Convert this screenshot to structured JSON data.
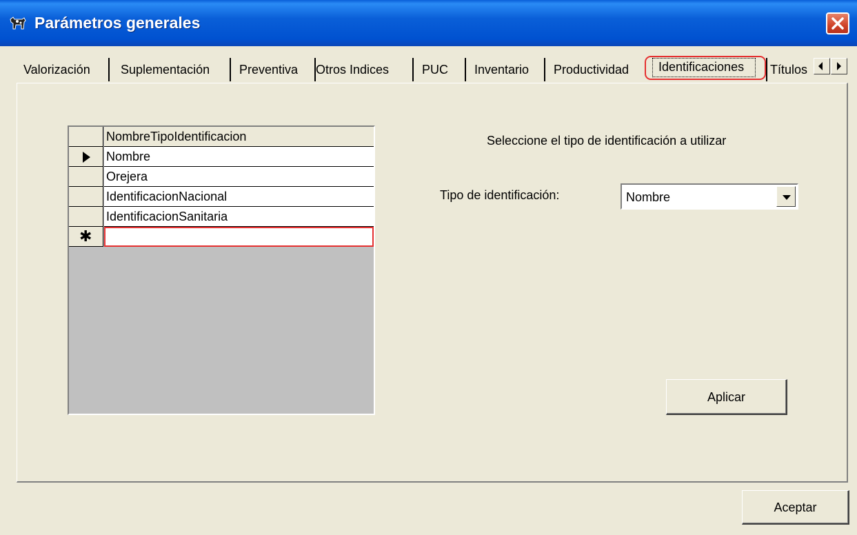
{
  "window": {
    "title": "Parámetros generales"
  },
  "tabs": [
    {
      "label": "Valorización"
    },
    {
      "label": "Suplementación"
    },
    {
      "label": "Preventiva"
    },
    {
      "label": "Otros Indices"
    },
    {
      "label": "PUC"
    },
    {
      "label": "Inventario"
    },
    {
      "label": "Productividad"
    },
    {
      "label": "Identificaciones",
      "active": true
    },
    {
      "label": "Títulos"
    }
  ],
  "grid": {
    "column_header": "NombreTipoIdentificacion",
    "rows": [
      "Nombre",
      "Orejera",
      "IdentificacionNacional",
      "IdentificacionSanitaria"
    ],
    "current_row_indicator": "triangle-right",
    "new_row_symbol": "✱"
  },
  "form": {
    "instruction": "Seleccione el tipo de identificación a utilizar",
    "type_label": "Tipo de identificación:",
    "type_value": "Nombre",
    "apply_label": "Aplicar"
  },
  "footer": {
    "ok_label": "Aceptar"
  },
  "colors": {
    "titlebar": "#0a5fd8",
    "face": "#ece9d8",
    "highlight": "#e53030"
  }
}
